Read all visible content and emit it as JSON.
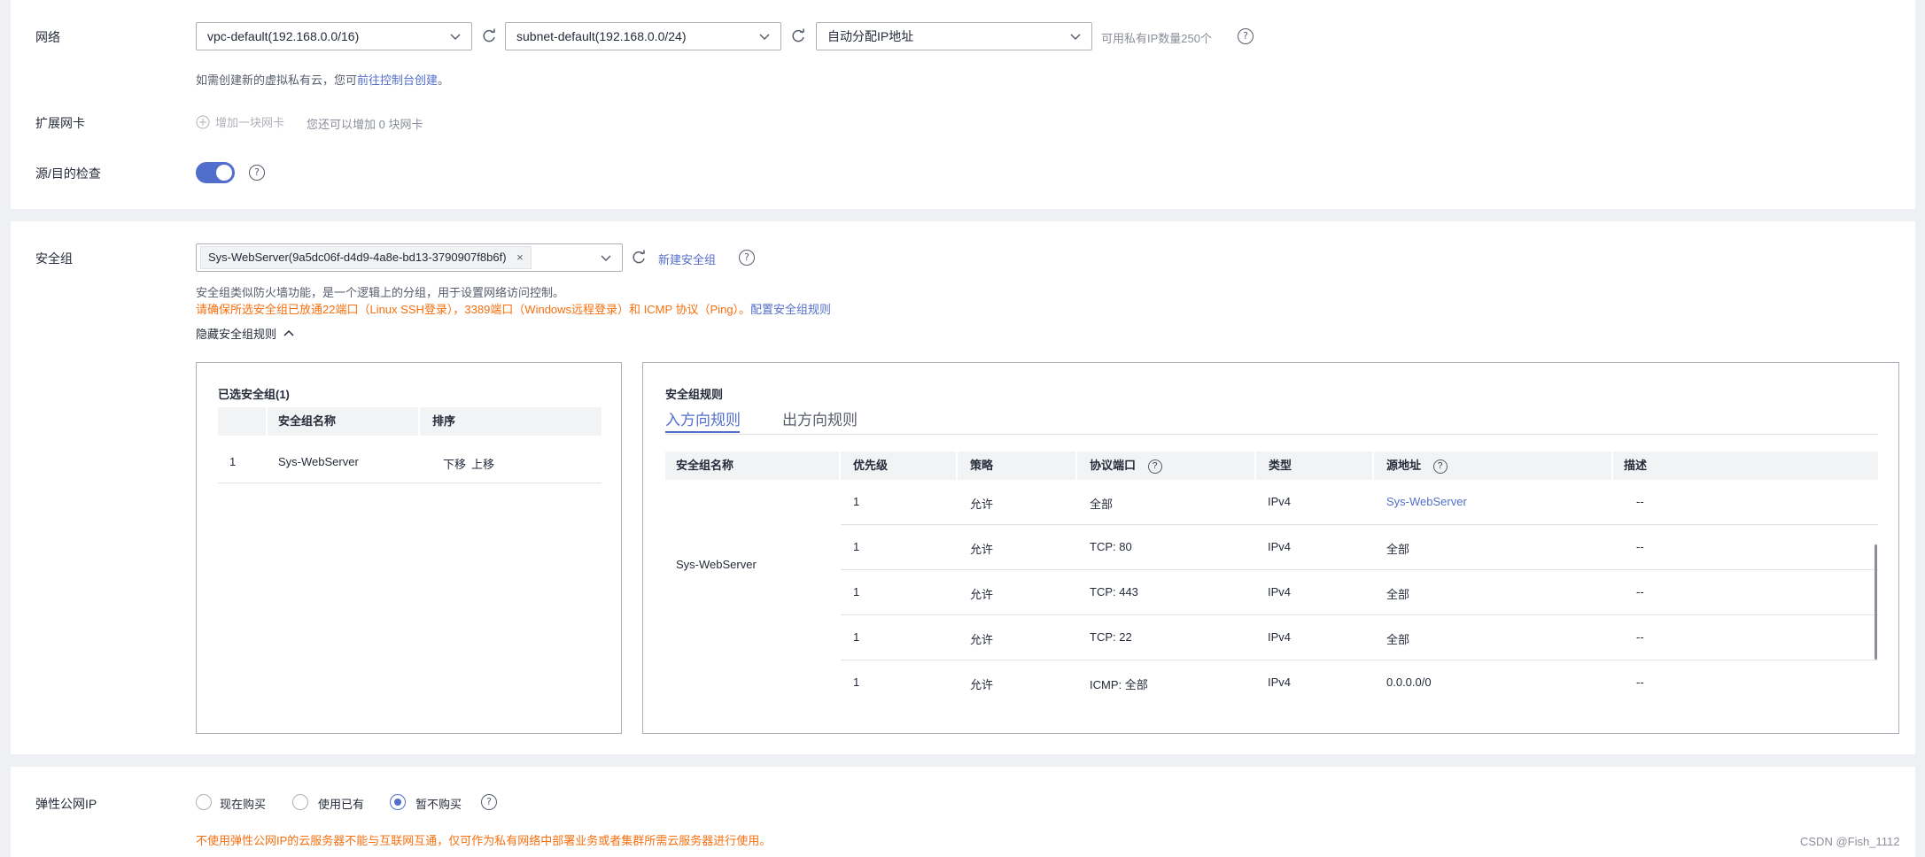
{
  "network": {
    "label": "网络",
    "vpc_value": "vpc-default(192.168.0.0/16)",
    "subnet_value": "subnet-default(192.168.0.0/24)",
    "ip_value": "自动分配IP地址",
    "available_ip": "可用私有IP数量250个",
    "hint_prefix": "如需创建新的虚拟私有云，您可",
    "hint_link": "前往控制台创建",
    "hint_suffix": "。"
  },
  "nic": {
    "label": "扩展网卡",
    "add_label": "增加一块网卡",
    "hint": "您还可以增加 0 块网卡"
  },
  "source_check": {
    "label": "源/目的检查",
    "enabled": true
  },
  "security_group": {
    "label": "安全组",
    "selected_tag": "Sys-WebServer(9a5dc06f-d4d9-4a8e-bd13-3790907f8b6f)",
    "new_link": "新建安全组",
    "desc": "安全组类似防火墙功能，是一个逻辑上的分组，用于设置网络访问控制。",
    "warning": "请确保所选安全组已放通22端口（Linux SSH登录），3389端口（Windows远程登录）和 ICMP 协议（Ping）。",
    "config_link": "配置安全组规则",
    "toggle_rules": "隐藏安全组规则",
    "selected_panel": {
      "title": "已选安全组(1)",
      "headers": [
        "",
        "安全组名称",
        "排序"
      ],
      "rows": [
        {
          "index": "1",
          "name": "Sys-WebServer",
          "down": "下移",
          "up": "上移"
        }
      ]
    },
    "rules_panel": {
      "title": "安全组规则",
      "tabs": [
        "入方向规则",
        "出方向规则"
      ],
      "active_tab": 0,
      "headers": [
        "安全组名称",
        "优先级",
        "策略",
        "协议端口",
        "类型",
        "源地址",
        "描述"
      ],
      "group_name": "Sys-WebServer",
      "rows": [
        {
          "priority": "1",
          "policy": "允许",
          "port": "全部",
          "type": "IPv4",
          "source": "Sys-WebServer",
          "desc": "--",
          "source_link": true
        },
        {
          "priority": "1",
          "policy": "允许",
          "port": "TCP: 80",
          "type": "IPv4",
          "source": "全部",
          "desc": "--",
          "source_link": false
        },
        {
          "priority": "1",
          "policy": "允许",
          "port": "TCP: 443",
          "type": "IPv4",
          "source": "全部",
          "desc": "--",
          "source_link": false
        },
        {
          "priority": "1",
          "policy": "允许",
          "port": "TCP: 22",
          "type": "IPv4",
          "source": "全部",
          "desc": "--",
          "source_link": false
        },
        {
          "priority": "1",
          "policy": "允许",
          "port": "ICMP: 全部",
          "type": "IPv4",
          "source": "0.0.0.0/0",
          "desc": "--",
          "source_link": false
        }
      ]
    }
  },
  "eip": {
    "label": "弹性公网IP",
    "options": [
      "现在购买",
      "使用已有",
      "暂不购买"
    ],
    "selected": 2,
    "warning": "不使用弹性公网IP的云服务器不能与互联网互通，仅可作为私有网络中部署业务或者集群所需云服务器进行使用。"
  },
  "watermark": "CSDN @Fish_1112",
  "colors": {
    "accent": "#526ecc",
    "warning": "#f66f0f",
    "text": "#252b3a",
    "muted": "#8a8e99"
  }
}
